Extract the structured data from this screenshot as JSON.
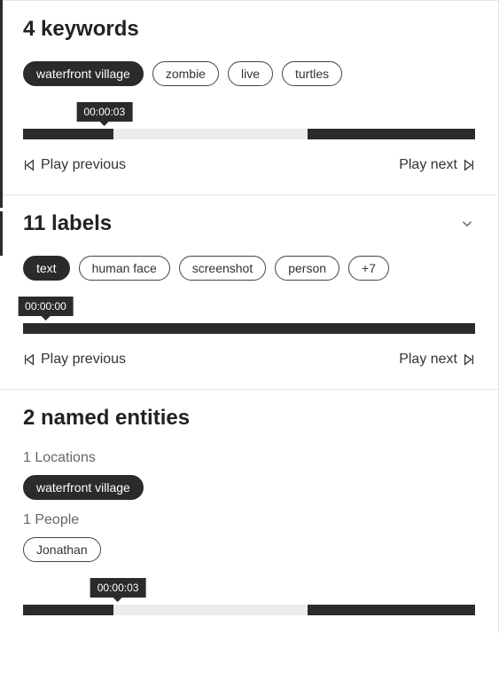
{
  "keywords": {
    "title": "4 keywords",
    "chips": [
      {
        "label": "waterfront village",
        "active": true
      },
      {
        "label": "zombie",
        "active": false
      },
      {
        "label": "live",
        "active": false
      },
      {
        "label": "turtles",
        "active": false
      }
    ],
    "timeline": {
      "tooltip": "00:00:03",
      "tooltipLeftPct": 18,
      "segments": [
        {
          "startPct": 0,
          "widthPct": 20
        },
        {
          "startPct": 63,
          "widthPct": 37
        }
      ]
    },
    "prev": "Play previous",
    "next": "Play next"
  },
  "labels": {
    "title": "11 labels",
    "chips": [
      {
        "label": "text",
        "active": true
      },
      {
        "label": "human face",
        "active": false
      },
      {
        "label": "screenshot",
        "active": false
      },
      {
        "label": "person",
        "active": false
      },
      {
        "label": "+7",
        "active": false
      }
    ],
    "timeline": {
      "tooltip": "00:00:00",
      "tooltipLeftPct": 5,
      "segments": [
        {
          "startPct": 0,
          "widthPct": 100
        }
      ]
    },
    "prev": "Play previous",
    "next": "Play next"
  },
  "entities": {
    "title": "2 named entities",
    "locations": {
      "heading": "1 Locations",
      "chips": [
        {
          "label": "waterfront village",
          "active": true
        }
      ]
    },
    "people": {
      "heading": "1 People",
      "chips": [
        {
          "label": "Jonathan",
          "active": false
        }
      ]
    },
    "timeline": {
      "tooltip": "00:00:03",
      "tooltipLeftPct": 21,
      "segments": [
        {
          "startPct": 0,
          "widthPct": 20
        },
        {
          "startPct": 63,
          "widthPct": 37
        }
      ]
    }
  }
}
